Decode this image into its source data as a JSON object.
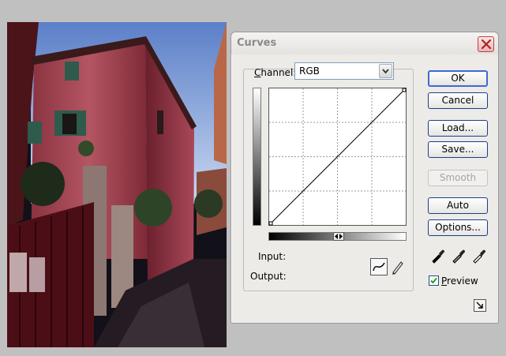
{
  "dialog": {
    "title": "Curves",
    "channel": {
      "label_mnemonic": "C",
      "label_rest": "hannel:",
      "value": "RGB"
    },
    "input_label": "Input:",
    "output_label": "Output:"
  },
  "buttons": {
    "ok": "OK",
    "cancel": "Cancel",
    "load": "Load...",
    "save": "Save...",
    "smooth": "Smooth",
    "auto": "Auto",
    "options": "Options..."
  },
  "preview": {
    "label_mnemonic": "P",
    "label_rest": "review",
    "checked": true
  },
  "icons": {
    "close": "close-icon",
    "dropdown": "chevron-down-icon",
    "curve_tool": "curve-tool-icon",
    "pencil_tool": "pencil-icon",
    "black_eyedropper": "black-point-eyedropper-icon",
    "gray_eyedropper": "gray-point-eyedropper-icon",
    "white_eyedropper": "white-point-eyedropper-icon",
    "expand": "expand-icon"
  },
  "colors": {
    "desktop": "#c0c0c0",
    "dialog_bg": "#ecebe8",
    "button_border": "#1c3d8a",
    "default_button_border": "#3d6ad6",
    "close_button": "#e9b3b3"
  }
}
